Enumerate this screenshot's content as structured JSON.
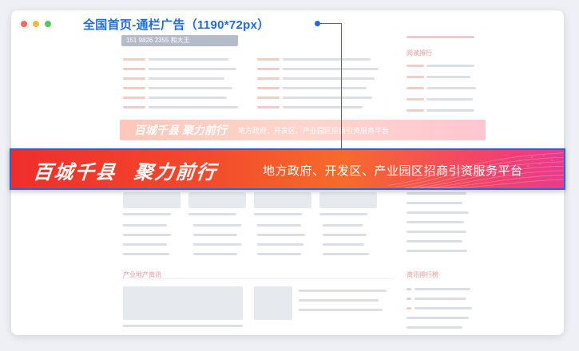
{
  "callout": {
    "label": "全国首页-通栏广告（1190*72px）",
    "color": "#1f6bd8"
  },
  "window": {
    "dots": [
      "#f26a5a",
      "#f7b93c",
      "#58c55b"
    ]
  },
  "ghost": {
    "phone": "151 9826 2355 和大王",
    "banner_slogan": "百城千县  聚力前行",
    "banner_sub": "地方政府、开发区、产业园区招商引资服务平台",
    "section_title": "产业地产资讯",
    "right_title": "资讯排行榜"
  },
  "banner": {
    "slogan_1": "百城千县",
    "slogan_2": "聚力前行",
    "subtitle": "地方政府、开发区、产业园区招商引资服务平台"
  }
}
